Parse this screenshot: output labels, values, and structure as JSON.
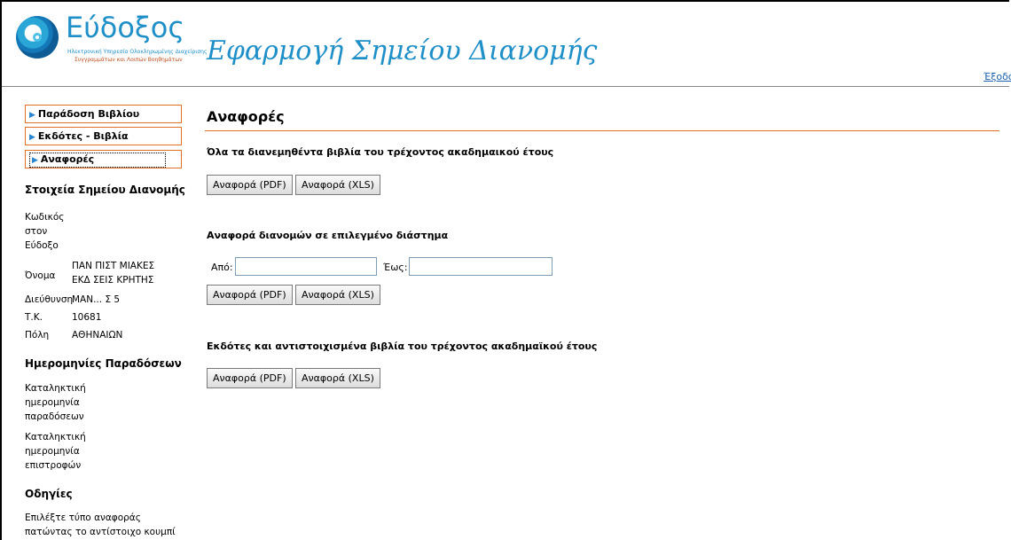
{
  "header": {
    "logo_word": "Εύδοξος",
    "logo_sub1": "Ηλεκτρονική Υπηρεσία Ολοκληρωμένης Διαχείρισης",
    "logo_sub2": "Συγγραμμάτων και Λοιπών Βοηθημάτων",
    "app_title": "Εφαρμογή Σημείου Διανομής",
    "logout": "Έξοδο"
  },
  "sidebar": {
    "menu": [
      {
        "label": "Παράδοση Βιβλίου"
      },
      {
        "label": "Εκδότες - Βιβλία"
      },
      {
        "label": "Αναφορές"
      }
    ],
    "point_heading": "Στοιχεία Σημείου Διανομής",
    "code_label": [
      "Κωδικός",
      "στον",
      "Εύδοξο"
    ],
    "name_label": "Όνομα",
    "name_value": [
      "ΠΑΝ  ΠΙΣΤ  ΜΙΑΚΕΣ",
      "ΕΚΔ  ΣΕΙΣ ΚΡΗΤΗΣ"
    ],
    "address_label": "Διεύθυνση",
    "address_value": "ΜΑΝ... Σ 5",
    "zip_label": "Τ.Κ.",
    "zip_value": "10681",
    "city_label": "Πόλη",
    "city_value": "ΑΘΗΝΑΙΩΝ",
    "dates_heading": "Ημερομηνίες Παραδόσεων",
    "deadline_delivery": [
      "Καταληκτική",
      "ημερομηνία",
      "παραδόσεων"
    ],
    "deadline_returns": [
      "Καταληκτική",
      "ημερομηνία",
      "επιστροφών"
    ],
    "instructions_heading": "Οδηγίες",
    "instructions_text": [
      "Επιλέξτε τύπο αναφοράς",
      "πατώντας το αντίστοιχο κουμπί"
    ]
  },
  "main": {
    "title": "Αναφορές",
    "section1": "Όλα τα διανεμηθέντα βιβλία του τρέχοντος ακαδημαικού έτους",
    "section2": "Αναφορά διανομών σε επιλεγμένο διάστημα",
    "section3": "Εκδότες και αντιστοιχισμένα βιβλία του τρέχοντος ακαδημαϊκού έτους",
    "from_label": "Από:",
    "to_label": "Έως:",
    "from_value": "",
    "to_value": "",
    "btn_pdf": "Αναφορά (PDF)",
    "btn_xls": "Αναφορά (XLS)"
  },
  "colors": {
    "accent_orange": "#e07028",
    "brand_blue": "#1f8fc8",
    "link_blue": "#1a5fb0"
  }
}
